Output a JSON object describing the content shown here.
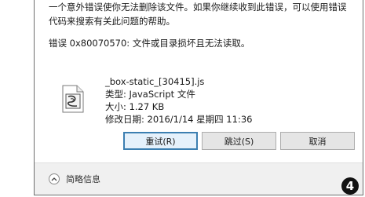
{
  "dialog": {
    "message": "一个意外错误使你无法删除该文件。如果你继续收到此错误，可以使用错误代码来搜索有关此问题的帮助。",
    "error_text": "错误 0x80070570: 文件或目录损坏且无法读取。"
  },
  "file": {
    "icon": "js-script-file-icon",
    "name": "_box-static_[30415].js",
    "type": "类型: JavaScript 文件",
    "size": "大小: 1.27 KB",
    "modified": "修改日期: 2016/1/14 星期四 11:36"
  },
  "buttons": {
    "retry": "重试(R)",
    "skip": "跳过(S)",
    "cancel": "取消"
  },
  "footer": {
    "details_label": "简略信息",
    "details_icon": "chevron-up-icon"
  },
  "badge": "4",
  "colors": {
    "primary_border": "#3c7fb1",
    "footer_bg": "#f0f0f0"
  }
}
